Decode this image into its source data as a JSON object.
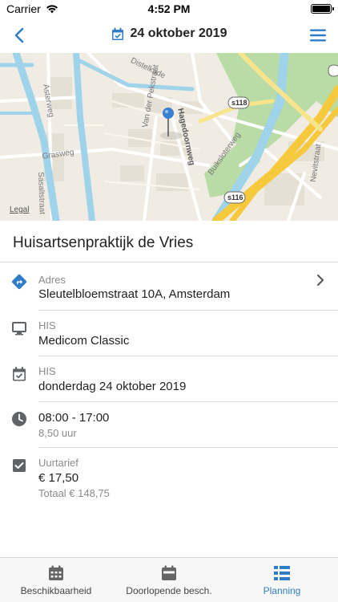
{
  "status_bar": {
    "carrier": "Carrier",
    "time": "4:52 PM"
  },
  "header": {
    "title": "24 oktober 2019",
    "back_icon": "chevron-left-icon",
    "calendar_icon": "calendar-check-icon",
    "menu_icon": "hamburger-menu-icon"
  },
  "map": {
    "legal": "Legal",
    "streets": [
      "Distelkade",
      "Asterweg",
      "Grasweg",
      "Sasaltstraat",
      "Van der Pekstraat",
      "Hagedoornweg",
      "Buiksloterweg",
      "Nevitstraat"
    ],
    "roads": [
      "s118",
      "s116"
    ]
  },
  "location": {
    "name": "Huisartsenpraktijk de Vries"
  },
  "details": [
    {
      "icon": "directions-icon",
      "label": "Adres",
      "value": "Sleutelbloemstraat 10A, Amsterdam",
      "sub": ""
    },
    {
      "icon": "monitor-icon",
      "label": "HIS",
      "value": "Medicom Classic",
      "sub": ""
    },
    {
      "icon": "calendar-icon",
      "label": "HIS",
      "value": "donderdag 24 oktober 2019",
      "sub": ""
    },
    {
      "icon": "clock-icon",
      "label": "",
      "value": "08:00 - 17:00",
      "sub": "8,50 uur"
    },
    {
      "icon": "checkbox-icon",
      "label": "Uurtarief",
      "value": "€ 17,50",
      "sub": "Totaal € 148,75"
    }
  ],
  "tabs": [
    {
      "label": "Beschikbaarheid",
      "icon": "calendar-grid-icon",
      "active": false
    },
    {
      "label": "Doorlopende besch.",
      "icon": "calendar-icon",
      "active": false
    },
    {
      "label": "Planning",
      "icon": "list-grid-icon",
      "active": true
    }
  ],
  "colors": {
    "accent": "#2f7dc7",
    "icon_gray": "#5f6368",
    "map_water": "#9fd3ea",
    "map_park": "#b9dca6",
    "map_highway": "#f6c93c"
  }
}
